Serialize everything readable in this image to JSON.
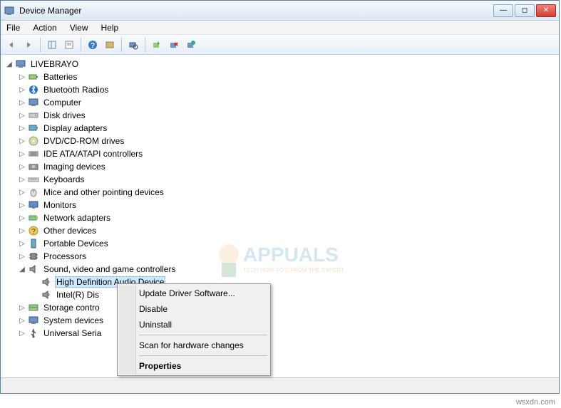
{
  "window": {
    "title": "Device Manager"
  },
  "menu": {
    "file": "File",
    "action": "Action",
    "view": "View",
    "help": "Help"
  },
  "tree": {
    "root": "LIVEBRAYO",
    "items": [
      "Batteries",
      "Bluetooth Radios",
      "Computer",
      "Disk drives",
      "Display adapters",
      "DVD/CD-ROM drives",
      "IDE ATA/ATAPI controllers",
      "Imaging devices",
      "Keyboards",
      "Mice and other pointing devices",
      "Monitors",
      "Network adapters",
      "Other devices",
      "Portable Devices",
      "Processors"
    ],
    "sound": {
      "label": "Sound, video and game controllers",
      "children": [
        "High Definition Audio Device",
        "Intel(R) Dis"
      ]
    },
    "after": [
      "Storage contro",
      "System devices",
      "Universal Seria"
    ]
  },
  "context": {
    "update": "Update Driver Software...",
    "disable": "Disable",
    "uninstall": "Uninstall",
    "scan": "Scan for hardware changes",
    "properties": "Properties"
  },
  "watermark": "wsxdn.com"
}
